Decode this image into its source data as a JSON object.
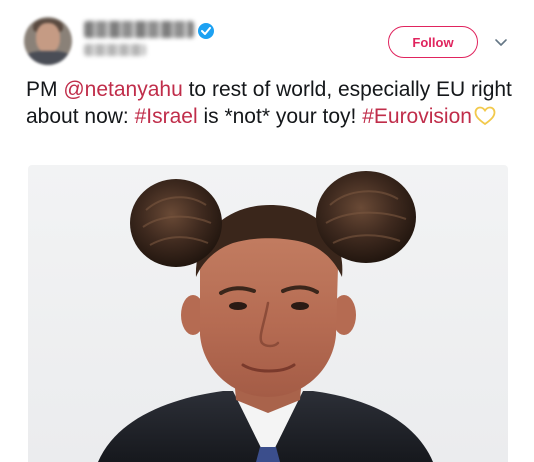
{
  "tweet": {
    "author": {
      "avatar_icon": "user-avatar-blurred",
      "verified_icon": "verified-badge-icon"
    },
    "follow_label": "Follow",
    "more_icon": "chevron-down-icon",
    "text_parts": {
      "p1": "PM ",
      "mention": "@netanyahu",
      "p2": " to rest of world, especially EU right about now: ",
      "hashtag1": "#Israel",
      "p3": " is *not* your toy! ",
      "hashtag2": "#Eurovision"
    },
    "emoji_icon": "yellow-heart-icon",
    "colors": {
      "accent": "#e0245e",
      "link": "#c02d4a",
      "verified": "#1da1f2",
      "heart": "#f2c94c"
    },
    "media": {
      "type": "photo"
    }
  }
}
